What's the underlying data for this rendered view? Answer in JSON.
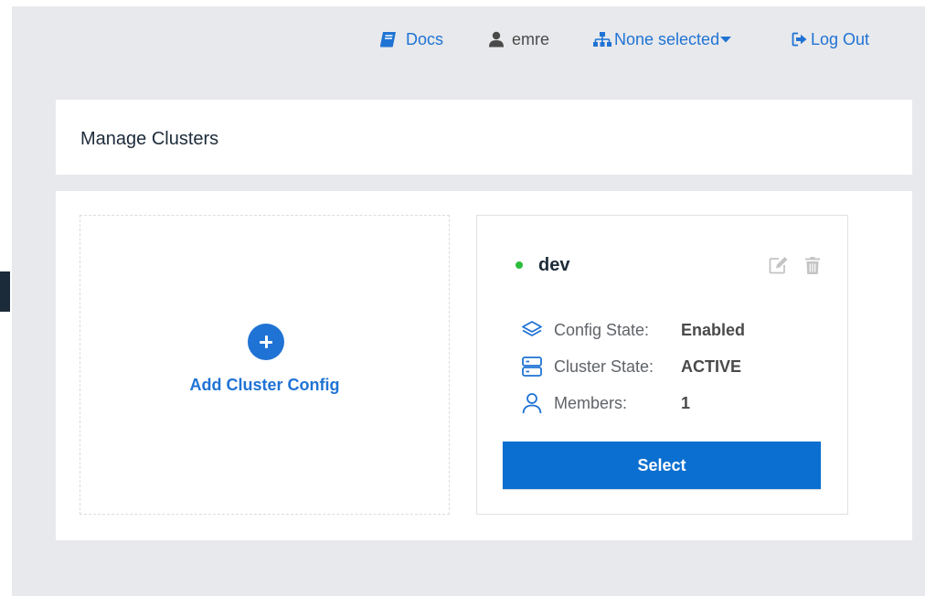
{
  "nav": {
    "docs_label": "Docs",
    "user_label": "emre",
    "cluster_select_label": "None selected",
    "logout_label": "Log Out"
  },
  "header": {
    "title": "Manage Clusters"
  },
  "add_card": {
    "label": "Add Cluster Config"
  },
  "cluster": {
    "name": "dev",
    "status": "active",
    "config_state_label": "Config State:",
    "config_state_value": "Enabled",
    "cluster_state_label": "Cluster State:",
    "cluster_state_value": "ACTIVE",
    "members_label": "Members:",
    "members_value": "1",
    "select_label": "Select"
  },
  "icons": {
    "docs": "book-icon",
    "user": "user-icon",
    "cluster_select": "sitemap-icon",
    "cluster_select_caret": "caret-down-icon",
    "logout": "sign-out-icon",
    "add": "plus-circle-icon",
    "edit": "edit-icon",
    "delete": "trash-icon",
    "config_state": "layers-icon",
    "cluster_state": "server-icon",
    "members": "person-icon"
  },
  "colors": {
    "accent": "#1f73d4",
    "button": "#0a6fd0",
    "status_active": "#2dbd3e",
    "background": "#e8e9ec"
  }
}
